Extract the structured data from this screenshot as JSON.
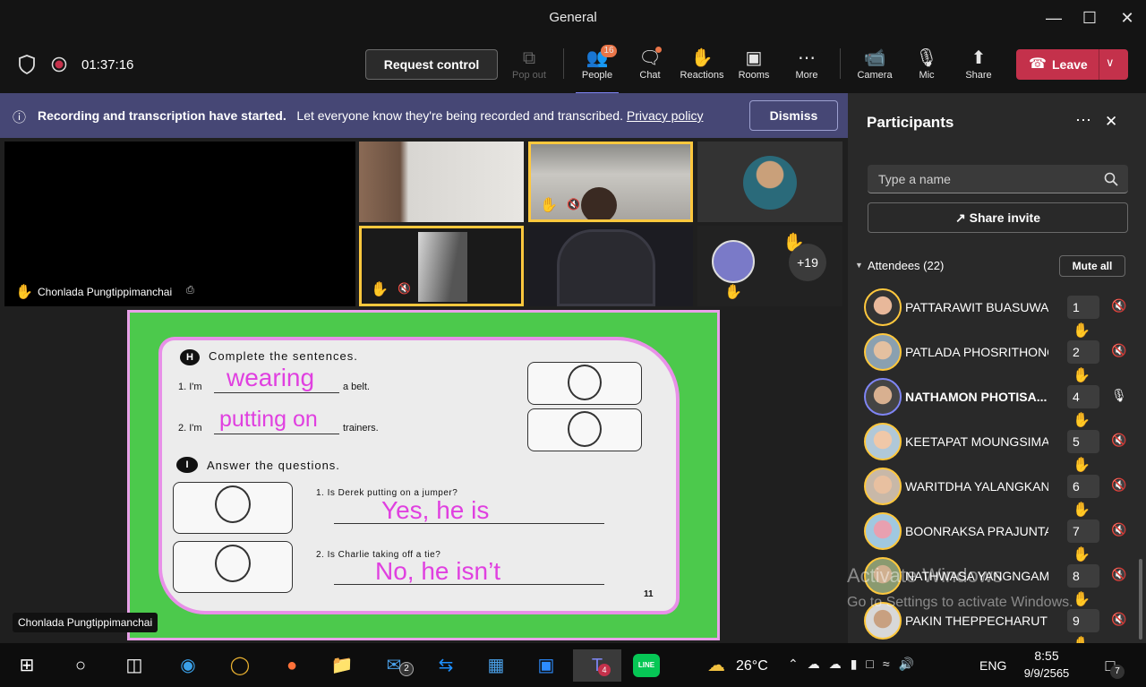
{
  "window": {
    "title": "General"
  },
  "toolbar": {
    "timer": "01:37:16",
    "request_control": "Request control",
    "popout": "Pop out",
    "people": "People",
    "people_badge": "16",
    "chat": "Chat",
    "reactions": "Reactions",
    "rooms": "Rooms",
    "more": "More",
    "camera": "Camera",
    "mic": "Mic",
    "share": "Share",
    "leave": "Leave"
  },
  "banner": {
    "bold": "Recording and transcription have started.",
    "text": "Let everyone know they're being recorded and transcribed.",
    "link": "Privacy policy",
    "dismiss": "Dismiss"
  },
  "stage": {
    "main_name": "Chonlada Pungtippimanchai",
    "overflow": "+19",
    "presenter_name": "Chonlada Pungtippimanchai"
  },
  "worksheet": {
    "h_label": "H",
    "h_title": "Complete the sentences.",
    "s1_pre": "1. I'm",
    "s1_answer": "wearing",
    "s1_post": "a belt.",
    "s2_pre": "2. I'm",
    "s2_answer": "putting on",
    "s2_post": "trainers.",
    "i_label": "I",
    "i_title": "Answer the questions.",
    "q1": "1. Is Derek putting on a jumper?",
    "a1": "Yes, he is",
    "q2": "2. Is Charlie taking off a tie?",
    "a2": "No, he isn’t",
    "page": "11"
  },
  "panel": {
    "title": "Participants",
    "search_placeholder": "Type a name",
    "share_invite": "Share invite",
    "attendees": "Attendees (22)",
    "mute_all": "Mute all",
    "participants": [
      {
        "name": "PATTARAWIT BUASUWAN",
        "num": "1",
        "bold": false
      },
      {
        "name": "PATLADA PHOSRITHONG",
        "num": "2",
        "bold": false
      },
      {
        "name": "NATHAMON PHOTISA...",
        "num": "4",
        "bold": true
      },
      {
        "name": "KEETAPAT MOUNGSIMA...",
        "num": "5",
        "bold": false
      },
      {
        "name": "WARITDHA YALANGKAN",
        "num": "6",
        "bold": false
      },
      {
        "name": "BOONRAKSA PRAJUNTA...",
        "num": "7",
        "bold": false
      },
      {
        "name": "NATHWASA YANGNGAM",
        "num": "8",
        "bold": false
      },
      {
        "name": "PAKIN THEPPECHARUT",
        "num": "9",
        "bold": false
      }
    ]
  },
  "watermark": {
    "line1": "Activate Windows",
    "line2": "Go to Settings to activate Windows."
  },
  "taskbar": {
    "temp": "26°C",
    "lang": "ENG",
    "time": "8:55",
    "date": "9/9/2565",
    "mail_badge": "2",
    "teams_badge": "4",
    "notif_badge": "7",
    "line_label": "LINE"
  },
  "colors": {
    "accent": "#6264a7",
    "leave": "#c4314b",
    "hand": "#ffc83d",
    "answer": "#e040e0",
    "slide_green": "#4cc94c"
  }
}
